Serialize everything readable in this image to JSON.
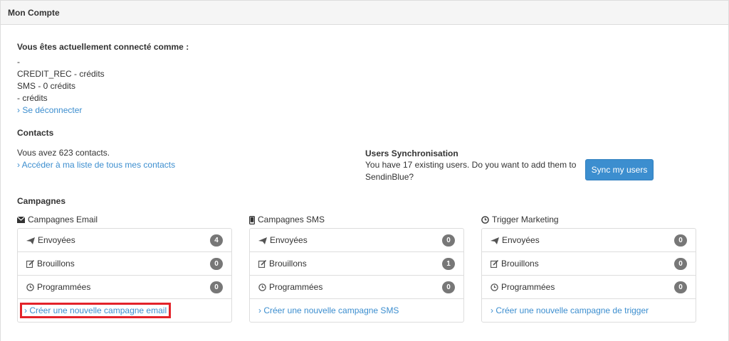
{
  "header": {
    "title": "Mon Compte"
  },
  "account": {
    "heading": "Vous êtes actuellement connecté comme :",
    "lines": [
      " -",
      "CREDIT_REC - crédits",
      "SMS - 0 crédits",
      "- crédits"
    ],
    "logout_link": "› Se déconnecter"
  },
  "contacts": {
    "heading": "Contacts",
    "count_text": "Vous avez 623 contacts.",
    "list_link": "› Accéder à ma liste de tous mes contacts"
  },
  "sync": {
    "heading": "Users Synchronisation",
    "text_line1": "You have 17 existing users. Do you want to add them to",
    "text_line2": "SendinBlue?",
    "button_label": "Sync my users"
  },
  "campaigns": {
    "heading": "Campagnes",
    "columns": [
      {
        "title": "Campagnes Email",
        "icon": "envelope-icon",
        "rows": [
          {
            "label": "Envoyées",
            "icon": "paper-plane-icon",
            "count": "4"
          },
          {
            "label": "Brouillons",
            "icon": "edit-icon",
            "count": "0"
          },
          {
            "label": "Programmées",
            "icon": "clock-icon",
            "count": "0"
          }
        ],
        "create_link": "› Créer une nouvelle campagne email"
      },
      {
        "title": "Campagnes SMS",
        "icon": "mobile-icon",
        "rows": [
          {
            "label": "Envoyées",
            "icon": "paper-plane-icon",
            "count": "0"
          },
          {
            "label": "Brouillons",
            "icon": "edit-icon",
            "count": "1"
          },
          {
            "label": "Programmées",
            "icon": "clock-icon",
            "count": "0"
          }
        ],
        "create_link": "› Créer une nouvelle campagne SMS"
      },
      {
        "title": "Trigger Marketing",
        "icon": "clock-icon",
        "rows": [
          {
            "label": "Envoyées",
            "icon": "paper-plane-icon",
            "count": "0"
          },
          {
            "label": "Brouillons",
            "icon": "edit-icon",
            "count": "0"
          },
          {
            "label": "Programmées",
            "icon": "clock-icon",
            "count": "0"
          }
        ],
        "create_link": "› Créer une nouvelle campagne de trigger"
      }
    ]
  },
  "colors": {
    "link": "#3c8ecf",
    "badge": "#777777",
    "highlight": "#e3232a",
    "button": "#3c8ecf"
  }
}
